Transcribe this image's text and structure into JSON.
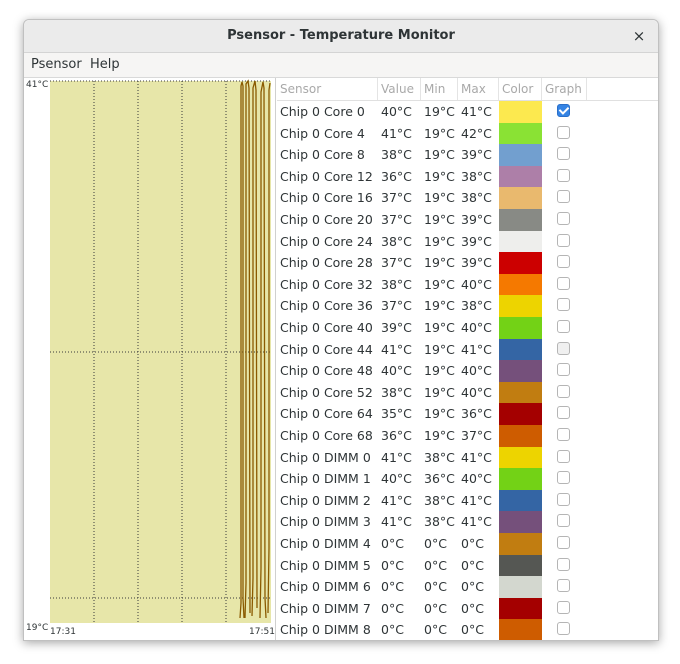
{
  "window": {
    "title": "Psensor - Temperature Monitor",
    "close_symbol": "×"
  },
  "menu": {
    "items": [
      "Psensor",
      "Help"
    ]
  },
  "graph": {
    "y_max_label": "41°C",
    "y_min_label": "19°C",
    "x_start_label": "17:31",
    "x_end_label": "17:51",
    "background_color": "#e7e6a9",
    "line_color": "#8a5a00"
  },
  "table": {
    "headers": [
      "Sensor",
      "Value",
      "Min",
      "Max",
      "Color",
      "Graph"
    ],
    "rows": [
      {
        "sensor": "Chip 0 Core 0",
        "value": "40°C",
        "min": "19°C",
        "max": "41°C",
        "color": "#fce94f",
        "graph": "checked"
      },
      {
        "sensor": "Chip 0 Core 4",
        "value": "41°C",
        "min": "19°C",
        "max": "42°C",
        "color": "#8ae234",
        "graph": "unchecked"
      },
      {
        "sensor": "Chip 0 Core 8",
        "value": "38°C",
        "min": "19°C",
        "max": "39°C",
        "color": "#729fcf",
        "graph": "unchecked"
      },
      {
        "sensor": "Chip 0 Core 12",
        "value": "36°C",
        "min": "19°C",
        "max": "38°C",
        "color": "#ad7fa8",
        "graph": "unchecked"
      },
      {
        "sensor": "Chip 0 Core 16",
        "value": "37°C",
        "min": "19°C",
        "max": "38°C",
        "color": "#e9b96e",
        "graph": "unchecked"
      },
      {
        "sensor": "Chip 0 Core 20",
        "value": "37°C",
        "min": "19°C",
        "max": "39°C",
        "color": "#888a85",
        "graph": "unchecked"
      },
      {
        "sensor": "Chip 0 Core 24",
        "value": "38°C",
        "min": "19°C",
        "max": "39°C",
        "color": "#eeeeec",
        "graph": "unchecked"
      },
      {
        "sensor": "Chip 0 Core 28",
        "value": "37°C",
        "min": "19°C",
        "max": "39°C",
        "color": "#cc0000",
        "graph": "unchecked"
      },
      {
        "sensor": "Chip 0 Core 32",
        "value": "38°C",
        "min": "19°C",
        "max": "40°C",
        "color": "#f57900",
        "graph": "unchecked"
      },
      {
        "sensor": "Chip 0 Core 36",
        "value": "37°C",
        "min": "19°C",
        "max": "38°C",
        "color": "#edd400",
        "graph": "unchecked"
      },
      {
        "sensor": "Chip 0 Core 40",
        "value": "39°C",
        "min": "19°C",
        "max": "40°C",
        "color": "#73d216",
        "graph": "unchecked"
      },
      {
        "sensor": "Chip 0 Core 44",
        "value": "41°C",
        "min": "19°C",
        "max": "41°C",
        "color": "#3465a4",
        "graph": "inconsistent"
      },
      {
        "sensor": "Chip 0 Core 48",
        "value": "40°C",
        "min": "19°C",
        "max": "40°C",
        "color": "#75507b",
        "graph": "unchecked"
      },
      {
        "sensor": "Chip 0 Core 52",
        "value": "38°C",
        "min": "19°C",
        "max": "40°C",
        "color": "#c17d11",
        "graph": "unchecked"
      },
      {
        "sensor": "Chip 0 Core 64",
        "value": "35°C",
        "min": "19°C",
        "max": "36°C",
        "color": "#a40000",
        "graph": "unchecked"
      },
      {
        "sensor": "Chip 0 Core 68",
        "value": "36°C",
        "min": "19°C",
        "max": "37°C",
        "color": "#ce5c00",
        "graph": "unchecked"
      },
      {
        "sensor": "Chip 0 DIMM 0",
        "value": "41°C",
        "min": "38°C",
        "max": "41°C",
        "color": "#edd400",
        "graph": "unchecked"
      },
      {
        "sensor": "Chip 0 DIMM 1",
        "value": "40°C",
        "min": "36°C",
        "max": "40°C",
        "color": "#73d216",
        "graph": "unchecked"
      },
      {
        "sensor": "Chip 0 DIMM 2",
        "value": "41°C",
        "min": "38°C",
        "max": "41°C",
        "color": "#3465a4",
        "graph": "unchecked"
      },
      {
        "sensor": "Chip 0 DIMM 3",
        "value": "41°C",
        "min": "38°C",
        "max": "41°C",
        "color": "#75507b",
        "graph": "unchecked"
      },
      {
        "sensor": "Chip 0 DIMM 4",
        "value": "0°C",
        "min": "0°C",
        "max": "0°C",
        "color": "#c17d11",
        "graph": "unchecked"
      },
      {
        "sensor": "Chip 0 DIMM 5",
        "value": "0°C",
        "min": "0°C",
        "max": "0°C",
        "color": "#555753",
        "graph": "unchecked"
      },
      {
        "sensor": "Chip 0 DIMM 6",
        "value": "0°C",
        "min": "0°C",
        "max": "0°C",
        "color": "#d3d7cf",
        "graph": "unchecked"
      },
      {
        "sensor": "Chip 0 DIMM 7",
        "value": "0°C",
        "min": "0°C",
        "max": "0°C",
        "color": "#a40000",
        "graph": "unchecked"
      },
      {
        "sensor": "Chip 0 DIMM 8",
        "value": "0°C",
        "min": "0°C",
        "max": "0°C",
        "color": "#ce5c00",
        "graph": "unchecked"
      }
    ]
  }
}
